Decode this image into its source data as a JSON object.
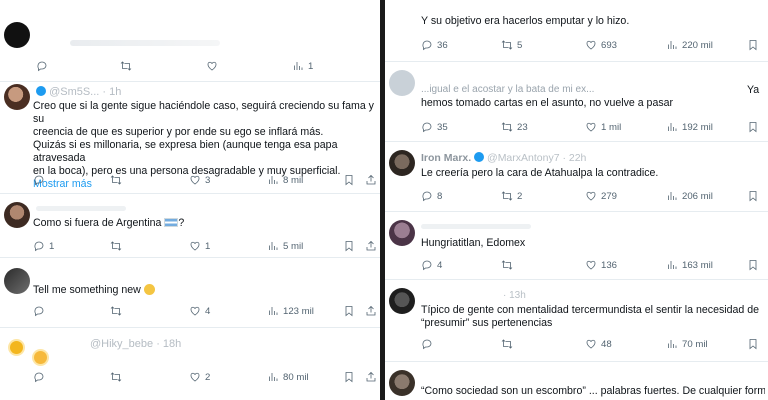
{
  "left": {
    "t0": {
      "views": "1"
    },
    "t1": {
      "header": "@Sm5S... · 1h",
      "lines": [
        "Creo que si la gente sigue haciéndole caso, seguirá creciendo su fama y su",
        "creencia de que es superior y por ende su ego se inflará más.",
        "Quizás si es millonaria, se expresa bien (aunque tenga esa papa atravesada",
        "en la boca), pero es una persona desagradable y muy superficial."
      ],
      "more": "Mostrar más",
      "likes": "3",
      "views": "8 mil"
    },
    "t2": {
      "text": "Como si fuera de Argentina ",
      "after_flag": "?",
      "replies": "1",
      "likes": "1",
      "views": "5 mil"
    },
    "t3": {
      "text": "Tell me something new ",
      "likes": "4",
      "views": "123 mil"
    },
    "t4": {
      "header": "@Hiky_bebe · 18h",
      "likes": "2",
      "views": "80 mil"
    }
  },
  "right": {
    "t0": {
      "text": "Y su objetivo era hacerlos emputar y lo hizo.",
      "replies": "36",
      "retweets": "5",
      "likes": "693",
      "views": "220 mil"
    },
    "t1": {
      "line1": "...igual e el acostar y la bata de mi ex...",
      "line1_right": "Ya",
      "line2": "hemos tomado cartas en el asunto, no vuelve a pasar",
      "replies": "35",
      "retweets": "23",
      "likes": "1 mil",
      "views": "192 mil"
    },
    "t2": {
      "name": "Iron Marx.",
      "handle": "@MarxAntony7 · 22h",
      "text": "Le creería pero la cara de Atahualpa la contradice.",
      "replies": "8",
      "retweets": "2",
      "likes": "279",
      "views": "206 mil"
    },
    "t3": {
      "text": "Hungriatitlan, Edomex",
      "replies": "4",
      "likes": "136",
      "views": "163 mil"
    },
    "t4": {
      "header": "· 13h",
      "line1": "Típico de gente con mentalidad tercermundista el sentir la necesidad de",
      "line2": "“presumir” sus pertenencias",
      "likes": "48",
      "views": "70 mil"
    },
    "t5": {
      "text": "“Como sociedad son un escombro” ... palabras fuertes. De cualquier forma,"
    }
  }
}
